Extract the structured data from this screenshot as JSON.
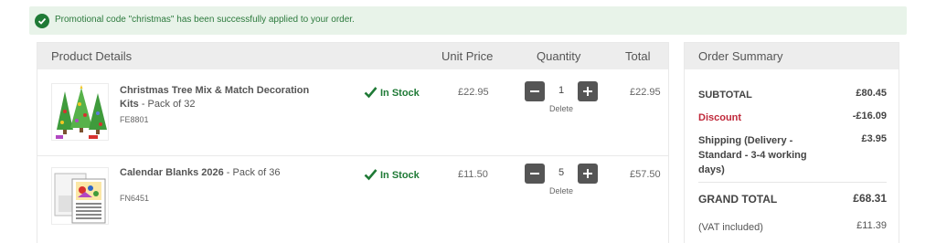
{
  "banner": {
    "message": "Promotional code \"christmas\" has been successfully applied to your order."
  },
  "cart": {
    "headers": {
      "product": "Product Details",
      "unit_price": "Unit Price",
      "quantity": "Quantity",
      "total": "Total"
    },
    "items": [
      {
        "name": "Christmas Tree Mix & Match Decoration Kits",
        "pack": " - Pack of 32",
        "sku": "FE8801",
        "stock": "In Stock",
        "unit_price": "£22.95",
        "quantity": "1",
        "delete": "Delete",
        "total": "£22.95"
      },
      {
        "name": "Calendar Blanks 2026",
        "pack": " - Pack of 36",
        "sku": "FN6451",
        "stock": "In Stock",
        "unit_price": "£11.50",
        "quantity": "5",
        "delete": "Delete",
        "total": "£57.50"
      }
    ]
  },
  "summary": {
    "title": "Order Summary",
    "subtotal_label": "SUBTOTAL",
    "subtotal": "£80.45",
    "discount_label": "Discount",
    "discount": "-£16.09",
    "shipping_label": "Shipping (Delivery - Standard - 3-4 working days)",
    "shipping": "£3.95",
    "grand_total_label": "GRAND TOTAL",
    "grand_total": "£68.31",
    "vat_label": "(VAT included)",
    "vat": "£11.39"
  },
  "colors": {
    "success_green": "#1f7a36",
    "discount_red": "#c0283a",
    "header_grey": "#ededed",
    "button_dark": "#555555"
  }
}
